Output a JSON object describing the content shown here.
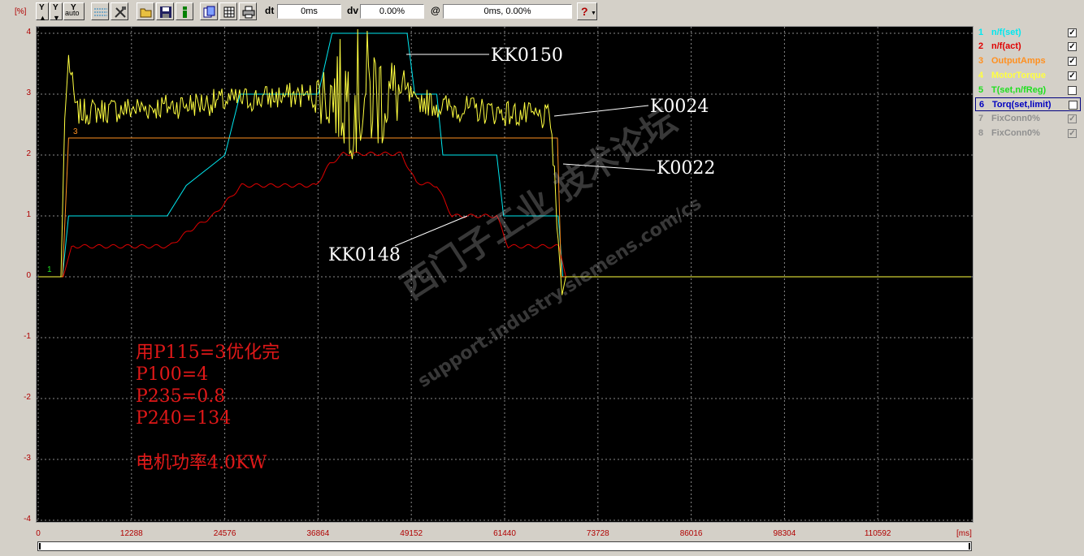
{
  "toolbar": {
    "unit_label": "[%]",
    "y_up_label": "Y",
    "y_down_label": "Y",
    "y_auto_label": "Y",
    "y_auto_sub": "auto",
    "dt_label": "dt",
    "dt_value": "0ms",
    "dv_label": "dv",
    "dv_value": "0.00%",
    "at_label": "@",
    "at_value": "0ms, 0.00%",
    "help_label": "?"
  },
  "legend": {
    "items": [
      {
        "num": "1",
        "name": "n/f(set)",
        "color": "#00e8f0",
        "checked": true,
        "enabled": true
      },
      {
        "num": "2",
        "name": "n/f(act)",
        "color": "#e00000",
        "checked": true,
        "enabled": true
      },
      {
        "num": "3",
        "name": "OutputAmps",
        "color": "#ff9020",
        "checked": true,
        "enabled": true
      },
      {
        "num": "4",
        "name": "MotorTorque",
        "color": "#ffff40",
        "checked": true,
        "enabled": true
      },
      {
        "num": "5",
        "name": "T(set,n/fReg)",
        "color": "#20e020",
        "checked": false,
        "enabled": true
      },
      {
        "num": "6",
        "name": "Torq(set,limit)",
        "color": "#0000c0",
        "checked": false,
        "enabled": true
      },
      {
        "num": "7",
        "name": "FixConn0%",
        "color": "#909090",
        "checked": true,
        "enabled": false
      },
      {
        "num": "8",
        "name": "FixConn0%",
        "color": "#909090",
        "checked": true,
        "enabled": false
      }
    ]
  },
  "chart_data": {
    "type": "line",
    "ylabel": "[%]",
    "xlabel": "[ms]",
    "ylim": [
      -4,
      4
    ],
    "xlim": [
      0,
      122880
    ],
    "yticks": [
      "4",
      "3",
      "2",
      "1",
      "0",
      "-1",
      "-2",
      "-3",
      "-4"
    ],
    "xticks": [
      "0",
      "12288",
      "24576",
      "36864",
      "49152",
      "61440",
      "73728",
      "86016",
      "98304",
      "110592"
    ],
    "grid": true,
    "series": [
      {
        "name": "n/f(set)",
        "color": "#00e8f0",
        "x": [
          0,
          3200,
          4000,
          17000,
          19500,
          24600,
          26600,
          36900,
          38700,
          48600,
          49600,
          52500,
          53300,
          60400,
          61300,
          68500,
          69100,
          122880
        ],
        "y": [
          0,
          0,
          1.0,
          1.0,
          1.5,
          2.0,
          3.0,
          3.0,
          4.0,
          4.0,
          3.0,
          3.0,
          2.0,
          2.0,
          1.0,
          1.0,
          0,
          0
        ]
      },
      {
        "name": "n/f(act)",
        "color": "#e00000",
        "x": [
          0,
          3300,
          4400,
          17300,
          19800,
          23000,
          26800,
          36600,
          38400,
          40200,
          47800,
          49800,
          52500,
          54500,
          60400,
          61900,
          68600,
          69500,
          122880
        ],
        "y": [
          0,
          0,
          0.5,
          0.5,
          0.75,
          1.0,
          1.5,
          1.5,
          1.85,
          2.02,
          2.02,
          1.55,
          1.5,
          1.0,
          1.0,
          0.5,
          0.5,
          0,
          0
        ]
      },
      {
        "name": "OutputAmps",
        "color": "#ff9020",
        "x": [
          0,
          3200,
          4000,
          68400,
          68900,
          122880
        ],
        "y": [
          0,
          0,
          2.28,
          2.28,
          0,
          0
        ]
      },
      {
        "name": "MotorTorque",
        "color": "#ffff40",
        "x": [
          0,
          3000,
          3500,
          4000,
          5000,
          17000,
          26000,
          36000,
          48000,
          53000,
          61000,
          67500,
          68500,
          69000,
          69500,
          122880
        ],
        "y": [
          0,
          0,
          2.6,
          3.6,
          2.7,
          2.8,
          2.9,
          3.0,
          3.0,
          2.8,
          2.7,
          2.6,
          0.6,
          -0.3,
          0,
          0
        ]
      }
    ]
  },
  "annotations": {
    "kk0150": "KK0150",
    "k0024": "K0024",
    "k0022": "K0022",
    "kk0148": "KK0148",
    "marker1": "1",
    "marker3": "3"
  },
  "notes": {
    "line1": "用P115=3优化完",
    "line2": "P100=4",
    "line3": "P235=0.8",
    "line4": "P240=134",
    "line5": "电机功率4.0KW"
  },
  "watermark": {
    "cn": "西门子工业 技术论坛",
    "url": "support.industry.siemens.com/cs"
  },
  "x_unit": "[ms]"
}
